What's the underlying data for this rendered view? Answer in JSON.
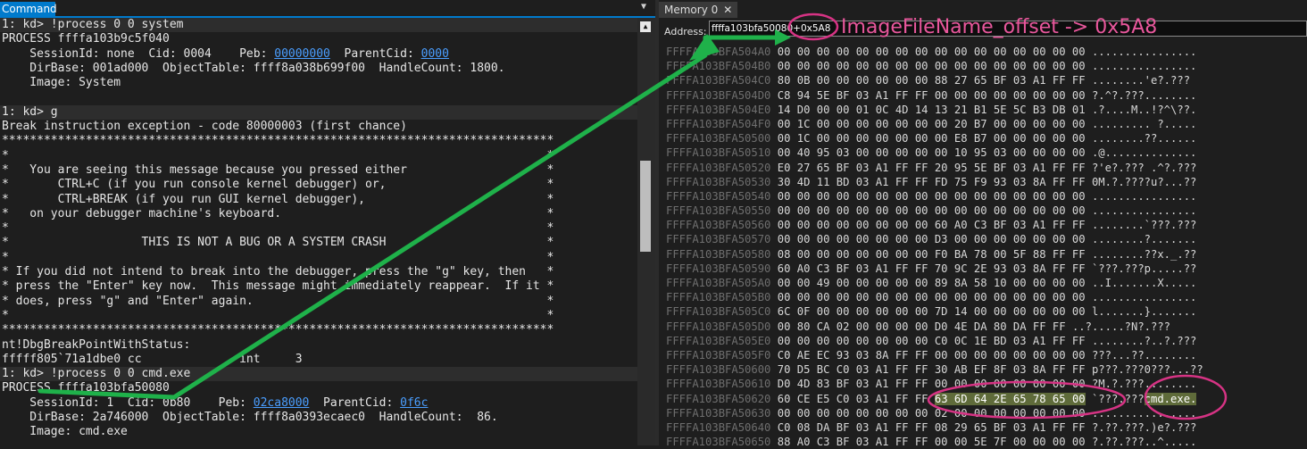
{
  "command_pane": {
    "tab_label": "Command",
    "dropdown_glyph": "▼",
    "lines": [
      {
        "text": "1: kd> !process 0 0 system",
        "kind": "prompt"
      },
      {
        "text": "PROCESS ffffa103b9c5f040"
      },
      {
        "segments": [
          {
            "t": "    SessionId: none  Cid: 0004    Peb: "
          },
          {
            "t": "00000000",
            "link": true
          },
          {
            "t": "  ParentCid: "
          },
          {
            "t": "0000",
            "link": true
          }
        ]
      },
      {
        "text": "    DirBase: 001ad000  ObjectTable: ffff8a038b699f00  HandleCount: 1800."
      },
      {
        "text": "    Image: System"
      },
      {
        "text": ""
      },
      {
        "text": "1: kd> g",
        "kind": "prompt"
      },
      {
        "text": "Break instruction exception - code 80000003 (first chance)"
      },
      {
        "text": "*******************************************************************************"
      },
      {
        "text": "*                                                                             *"
      },
      {
        "text": "*   You are seeing this message because you pressed either                    *"
      },
      {
        "text": "*       CTRL+C (if you run console kernel debugger) or,                       *"
      },
      {
        "text": "*       CTRL+BREAK (if you run GUI kernel debugger),                          *"
      },
      {
        "text": "*   on your debugger machine's keyboard.                                      *"
      },
      {
        "text": "*                                                                             *"
      },
      {
        "text": "*                   THIS IS NOT A BUG OR A SYSTEM CRASH                       *"
      },
      {
        "text": "*                                                                             *"
      },
      {
        "text": "* If you did not intend to break into the debugger, press the \"g\" key, then   *"
      },
      {
        "text": "* press the \"Enter\" key now.  This message might immediately reappear.  If it *"
      },
      {
        "text": "* does, press \"g\" and \"Enter\" again.                                          *"
      },
      {
        "text": "*                                                                             *"
      },
      {
        "text": "*******************************************************************************"
      },
      {
        "text": "nt!DbgBreakPointWithStatus:"
      },
      {
        "text": "fffff805`71a1dbe0 cc              int     3"
      },
      {
        "text": "1: kd> !process 0 0 cmd.exe",
        "kind": "prompt"
      },
      {
        "text": "PROCESS ffffa103bfa50080"
      },
      {
        "segments": [
          {
            "t": "    SessionId: 1  Cid: 0b80    Peb: "
          },
          {
            "t": "02ca8000",
            "link": true
          },
          {
            "t": "  ParentCid: "
          },
          {
            "t": "0f6c",
            "link": true
          }
        ]
      },
      {
        "text": "    DirBase: 2a746000  ObjectTable: ffff8a0393ecaec0  HandleCount:  86."
      },
      {
        "text": "    Image: cmd.exe"
      }
    ]
  },
  "memory_pane": {
    "tab_label": "Memory 0",
    "tab_close": "✕",
    "address_label": "Address:",
    "address_value": "ffffa103bfa50080+0x5A8",
    "rows": [
      {
        "addr": "FFFFA103BFA504A0",
        "bytes": "00 00 00 00 00 00 00 00 00 00 00 00 00 00 00 00",
        "ascii": "................"
      },
      {
        "addr": "FFFFA103BFA504B0",
        "bytes": "00 00 00 00 00 00 00 00 00 00 00 00 00 00 00 00",
        "ascii": "................"
      },
      {
        "addr": "FFFFA103BFA504C0",
        "bytes": "80 0B 00 00 00 00 00 00 88 27 65 BF 03 A1 FF FF",
        "ascii": "........'e?.???"
      },
      {
        "addr": "FFFFA103BFA504D0",
        "bytes": "C8 94 5E BF 03 A1 FF FF 00 00 00 00 00 00 00 00",
        "ascii": "?.^?.???........"
      },
      {
        "addr": "FFFFA103BFA504E0",
        "bytes": "14 D0 00 00 01 0C 4D 14 13 21 B1 5E 5C B3 DB 01",
        "ascii": ".?....M..!?^\\??."
      },
      {
        "addr": "FFFFA103BFA504F0",
        "bytes": "00 1C 00 00 00 00 00 00 00 20 B7 00 00 00 00 00",
        "ascii": "......... ?....."
      },
      {
        "addr": "FFFFA103BFA50500",
        "bytes": "00 1C 00 00 00 00 00 00 00 E8 B7 00 00 00 00 00",
        "ascii": "........??......"
      },
      {
        "addr": "FFFFA103BFA50510",
        "bytes": "00 40 95 03 00 00 00 00 00 10 95 03 00 00 00 00",
        "ascii": ".@.............."
      },
      {
        "addr": "FFFFA103BFA50520",
        "bytes": "E0 27 65 BF 03 A1 FF FF 20 95 5E BF 03 A1 FF FF",
        "ascii": "?'e?.??? .^?.???"
      },
      {
        "addr": "FFFFA103BFA50530",
        "bytes": "30 4D 11 BD 03 A1 FF FF FD 75 F9 93 03 8A FF FF",
        "ascii": "0M.?.????u?...??"
      },
      {
        "addr": "FFFFA103BFA50540",
        "bytes": "00 00 00 00 00 00 00 00 00 00 00 00 00 00 00 00",
        "ascii": "................"
      },
      {
        "addr": "FFFFA103BFA50550",
        "bytes": "00 00 00 00 00 00 00 00 00 00 00 00 00 00 00 00",
        "ascii": "................"
      },
      {
        "addr": "FFFFA103BFA50560",
        "bytes": "00 00 00 00 00 00 00 00 60 A0 C3 BF 03 A1 FF FF",
        "ascii": "........`???.???"
      },
      {
        "addr": "FFFFA103BFA50570",
        "bytes": "00 00 00 00 00 00 00 00 D3 00 00 00 00 00 00 00",
        "ascii": "........?......."
      },
      {
        "addr": "FFFFA103BFA50580",
        "bytes": "08 00 00 00 00 00 00 00 F0 BA 78 00 5F 88 FF FF",
        "ascii": "........??x._.??"
      },
      {
        "addr": "FFFFA103BFA50590",
        "bytes": "60 A0 C3 BF 03 A1 FF FF 70 9C 2E 93 03 8A FF FF",
        "ascii": "`???.???p.....??"
      },
      {
        "addr": "FFFFA103BFA505A0",
        "bytes": "00 00 49 00 00 00 00 00 89 8A 58 10 00 00 00 00",
        "ascii": "..I.......X....."
      },
      {
        "addr": "FFFFA103BFA505B0",
        "bytes": "00 00 00 00 00 00 00 00 00 00 00 00 00 00 00 00",
        "ascii": "................"
      },
      {
        "addr": "FFFFA103BFA505C0",
        "bytes": "6C 0F 00 00 00 00 00 00 7D 14 00 00 00 00 00 00",
        "ascii": "l.......}......."
      },
      {
        "addr": "FFFFA103BFA505D0",
        "bytes": "00 80 CA 02 00 00 00 00 D0 4E DA 80 DA FF FF",
        "ascii": "..?.....?N?.???"
      },
      {
        "addr": "FFFFA103BFA505E0",
        "bytes": "00 00 00 00 00 00 00 00 C0 0C 1E BD 03 A1 FF FF",
        "ascii": "........?..?.???"
      },
      {
        "addr": "FFFFA103BFA505F0",
        "bytes": "C0 AE EC 93 03 8A FF FF 00 00 00 00 00 00 00 00",
        "ascii": "???...??........"
      },
      {
        "addr": "FFFFA103BFA50600",
        "bytes": "70 D5 BC C0 03 A1 FF FF 30 AB EF 8F 03 8A FF FF",
        "ascii": "p???.???0???...??"
      },
      {
        "addr": "FFFFA103BFA50610",
        "bytes": "D0 4D 83 BF 03 A1 FF FF 00 00 00 00 00 00 00 00",
        "ascii": "?M.?.???........"
      },
      {
        "addr": "FFFFA103BFA50620",
        "bytes_pre": "60 CE E5 C0 03 A1 FF FF ",
        "bytes_hl": "63 6D 64 2E 65 78 65 00",
        "ascii_pre": "`???.???",
        "ascii_hl": "cmd.exe."
      },
      {
        "addr": "FFFFA103BFA50630",
        "bytes": "00 00 00 00 00 00 00 00 02 00 00 00 00 00 00 00",
        "ascii": "................"
      },
      {
        "addr": "FFFFA103BFA50640",
        "bytes": "C0 08 DA BF 03 A1 FF FF 08 29 65 BF 03 A1 FF FF",
        "ascii": "?.??.???.)e?.???"
      },
      {
        "addr": "FFFFA103BFA50650",
        "bytes": "88 A0 C3 BF 03 A1 FF FF 00 00 5E 7F 00 00 00 00",
        "ascii": "?.??.???..^....."
      }
    ]
  },
  "annotation": {
    "text": "ImageFileName_offset -> 0x5A8",
    "arrow_color": "#1fb14a",
    "circle_color": "#d63384"
  }
}
